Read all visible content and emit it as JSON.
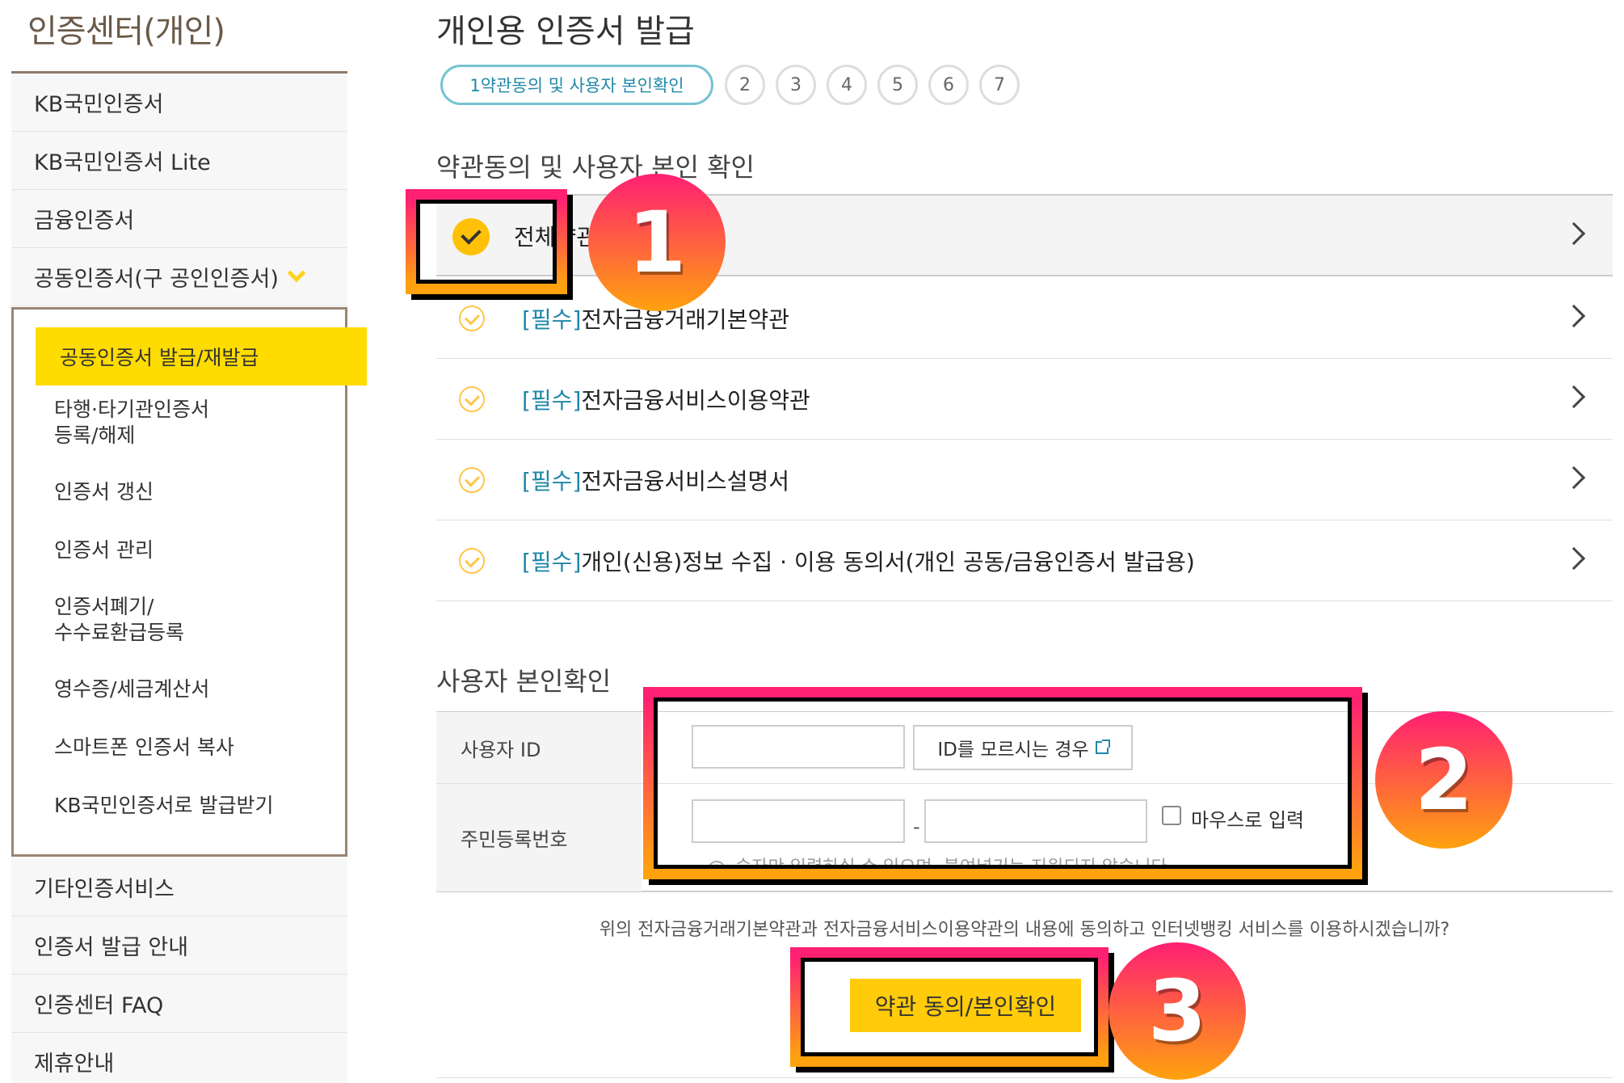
{
  "sidebar": {
    "title": "인증센터(개인)",
    "items_top": [
      "KB국민인증서",
      "KB국민인증서 Lite",
      "금융인증서",
      "공동인증서(구 공인인증서)"
    ],
    "submenu": {
      "active": "공동인증서 발급/재발급",
      "items": [
        "타행·타기관인증서\n등록/해제",
        "인증서 갱신",
        "인증서 관리",
        "인증서폐기/\n수수료환급등록",
        "영수증/세금계산서",
        "스마트폰 인증서 복사",
        "KB국민인증서로 발급받기"
      ]
    },
    "items_bottom": [
      "기타인증서비스",
      "인증서 발급 안내",
      "인증센터 FAQ",
      "제휴안내"
    ]
  },
  "main": {
    "page_title": "개인용 인증서 발급",
    "steps": {
      "active_label": "1약관동의 및 사용자 본인확인",
      "numbers": [
        "2",
        "3",
        "4",
        "5",
        "6",
        "7"
      ]
    },
    "terms_section_title": "약관동의 및 사용자 본인 확인",
    "all_agree_label": "전체약관동의",
    "terms": [
      {
        "tag": "[필수]",
        "label": "전자금융거래기본약관"
      },
      {
        "tag": "[필수]",
        "label": "전자금융서비스이용약관"
      },
      {
        "tag": "[필수]",
        "label": "전자금융서비스설명서"
      },
      {
        "tag": "[필수]",
        "label": "개인(신용)정보 수집 · 이용 동의서(개인 공동/금융인증서 발급용)"
      }
    ],
    "identity_section_title": "사용자 본인확인",
    "form": {
      "user_id_label": "사용자 ID",
      "user_id_value": "",
      "find_id_button": "ID를 모르시는 경우",
      "rrn_label": "주민등록번호",
      "rrn_front_value": "",
      "rrn_back_value": "",
      "rrn_dash": "-",
      "mouse_input_label": "마우스로 입력",
      "hint": "숫자만 입력하실 수 있으며, 붙여넣기는 지원되지 않습니다."
    },
    "question": "위의 전자금융거래기본약관과 전자금융서비스이용약관의 내용에 동의하고 인터넷뱅킹 서비스를 이용하시겠습니까?",
    "agree_button": "약관 동의/본인확인"
  },
  "annotations": {
    "badges": [
      "1",
      "2",
      "3"
    ],
    "gradient_colors": [
      "#ff1f73",
      "#ffa20e"
    ]
  },
  "colors": {
    "accent_yellow": "#ffdc00",
    "button_yellow": "#ffcb0a",
    "tag_blue": "#1f87a8",
    "step_border": "#76c3d1"
  }
}
